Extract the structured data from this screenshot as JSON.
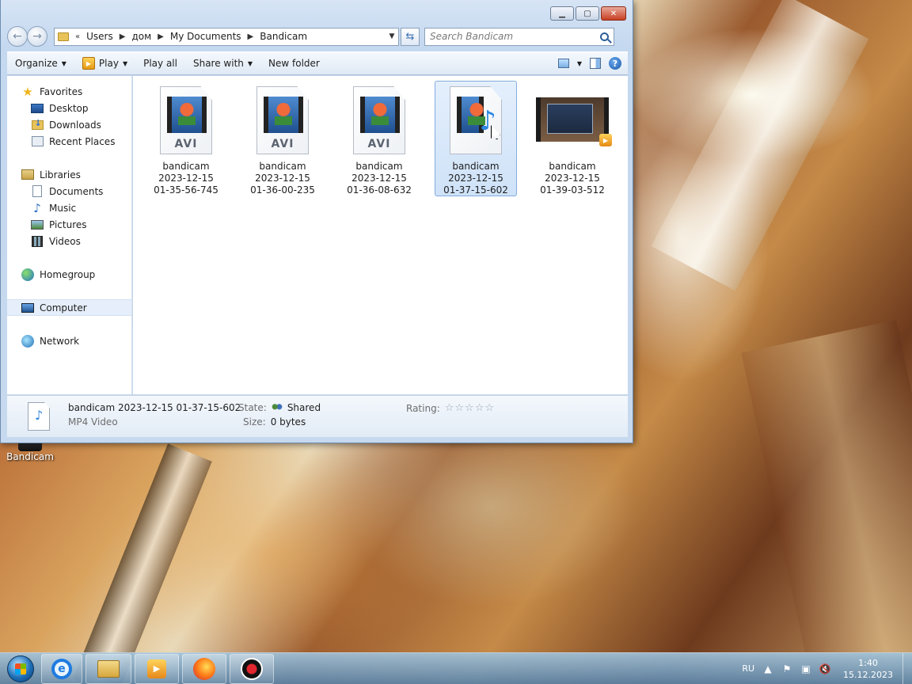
{
  "window": {
    "breadcrumb": [
      "Users",
      "дом",
      "My Documents",
      "Bandicam"
    ],
    "breadcrumb_prefix": "«",
    "search_placeholder": "Search Bandicam",
    "caption_buttons": [
      "minimize",
      "maximize",
      "close"
    ]
  },
  "toolbar": {
    "organize": "Organize",
    "play": "Play",
    "play_all": "Play all",
    "share_with": "Share with",
    "new_folder": "New folder"
  },
  "nav_pane": {
    "favorites": "Favorites",
    "desktop": "Desktop",
    "downloads": "Downloads",
    "recent_places": "Recent Places",
    "libraries": "Libraries",
    "documents": "Documents",
    "music": "Music",
    "pictures": "Pictures",
    "videos": "Videos",
    "homegroup": "Homegroup",
    "computer": "Computer",
    "network": "Network"
  },
  "files": [
    {
      "name": "bandicam",
      "date": "2023-12-15",
      "time": "01-35-56-745",
      "kind": "AVI",
      "tag": "AVI"
    },
    {
      "name": "bandicam",
      "date": "2023-12-15",
      "time": "01-36-00-235",
      "kind": "AVI",
      "tag": "AVI"
    },
    {
      "name": "bandicam",
      "date": "2023-12-15",
      "time": "01-36-08-632",
      "kind": "AVI",
      "tag": "AVI"
    },
    {
      "name": "bandicam",
      "date": "2023-12-15",
      "time": "01-37-15-602",
      "kind": "MP4-audio",
      "tag": ""
    },
    {
      "name": "bandicam",
      "date": "2023-12-15",
      "time": "01-39-03-512",
      "kind": "video-thumb",
      "tag": ""
    }
  ],
  "details": {
    "name": "bandicam 2023-12-15 01-37-15-602",
    "type": "MP4 Video",
    "state_label": "State:",
    "state_value": "Shared",
    "size_label": "Size:",
    "size_value": "0 bytes",
    "rating_label": "Rating:",
    "rating_value": 0
  },
  "desktop": {
    "icon_label": "Bandicam"
  },
  "taskbar": {
    "lang": "RU",
    "time": "1:40",
    "date": "15.12.2023"
  }
}
